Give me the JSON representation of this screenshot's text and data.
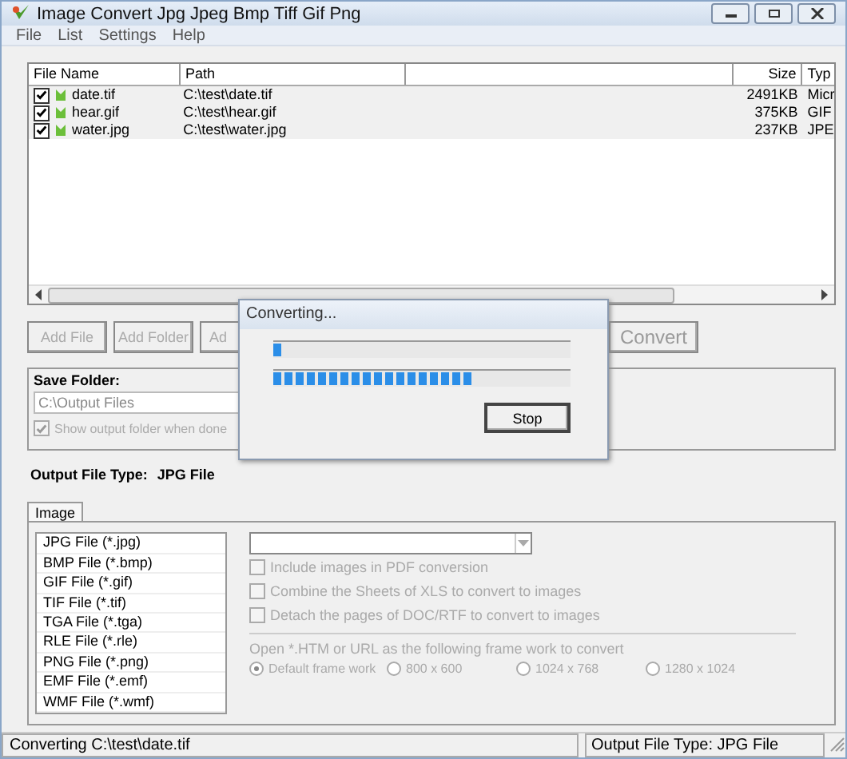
{
  "window": {
    "title": "Image Convert Jpg Jpeg Bmp Tiff Gif Png"
  },
  "menu": [
    "File",
    "List",
    "Settings",
    "Help"
  ],
  "file_list": {
    "columns": [
      "File Name",
      "Path",
      "Size",
      "Typ"
    ],
    "rows": [
      {
        "name": "date.tif",
        "path": "C:\\test\\date.tif",
        "size": "2491KB",
        "type": "Micr",
        "checked": true
      },
      {
        "name": "hear.gif",
        "path": "C:\\test\\hear.gif",
        "size": "375KB",
        "type": "GIF",
        "checked": true
      },
      {
        "name": "water.jpg",
        "path": "C:\\test\\water.jpg",
        "size": "237KB",
        "type": "JPE",
        "checked": true
      }
    ]
  },
  "buttons": [
    "Add File",
    "Add Folder",
    "Ad"
  ],
  "convert_button": "Convert",
  "save_folder": {
    "label": "Save Folder:",
    "value": "C:\\Output Files",
    "show_folder": {
      "label": "Show output folder when done",
      "checked": true
    }
  },
  "output_type": {
    "label": "Output File Type:",
    "value": "JPG File"
  },
  "tabs": [
    {
      "label": "Image",
      "selected": true
    }
  ],
  "formats": [
    "JPG File  (*.jpg)",
    "BMP File  (*.bmp)",
    "GIF File  (*.gif)",
    "TIF File  (*.tif)",
    "TGA File  (*.tga)",
    "RLE File  (*.rle)",
    "PNG File  (*.png)",
    "EMF File  (*.emf)",
    "WMF File  (*.wmf)"
  ],
  "options": [
    {
      "label": "Include images in PDF conversion",
      "checked": false
    },
    {
      "label": "Combine the Sheets of XLS to convert to images",
      "checked": false
    },
    {
      "label": "Detach the pages of DOC/RTF to convert to images",
      "checked": false
    }
  ],
  "frame_label": "Open *.HTM or URL as the following frame work to convert",
  "frames": [
    {
      "label": "Default frame work",
      "selected": true
    },
    {
      "label": "800 x 600",
      "selected": false
    },
    {
      "label": "1024 x 768",
      "selected": false
    },
    {
      "label": "1280 x 1024",
      "selected": false
    }
  ],
  "dialog": {
    "title": "Converting...",
    "progress": [
      {
        "level": 0.03
      },
      {
        "level": 0.67
      }
    ],
    "button": "Stop"
  },
  "status_bar": [
    "Converting  C:\\test\\date.tif",
    "Output File Type:  JPG File"
  ]
}
